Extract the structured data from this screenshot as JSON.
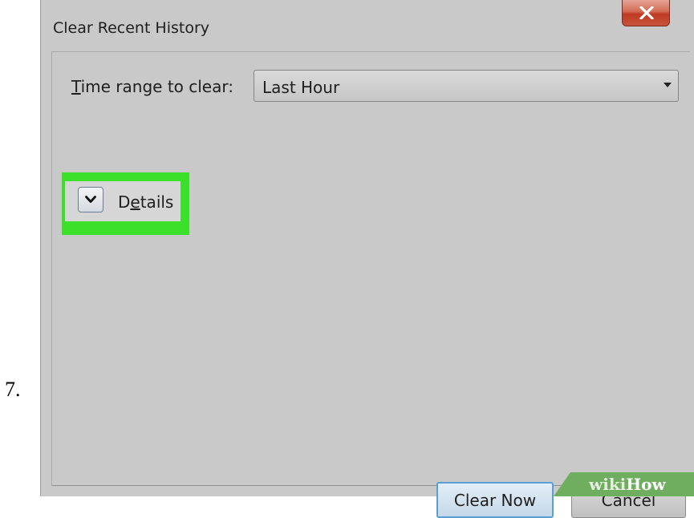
{
  "step": {
    "number": "7."
  },
  "dialog": {
    "title": "Clear Recent History",
    "time_range": {
      "label_underlined": "T",
      "label_rest": "ime range to clear:",
      "selected": "Last Hour"
    },
    "details": {
      "label_pre": "D",
      "label_underlined": "e",
      "label_post": "tails"
    },
    "buttons": {
      "clear_now": "Clear Now",
      "cancel": "Cancel"
    }
  },
  "watermark": {
    "part1": "wiki",
    "part2": "How"
  },
  "colors": {
    "highlight": "#3ce02a",
    "close_button": "#c8533c",
    "dialog_background": "#c9c9c9",
    "primary_button_border": "#5a9fd4"
  },
  "icons": {
    "close": "close-icon",
    "select_arrow": "chevron-down-icon",
    "details_toggle": "chevron-down-icon"
  }
}
